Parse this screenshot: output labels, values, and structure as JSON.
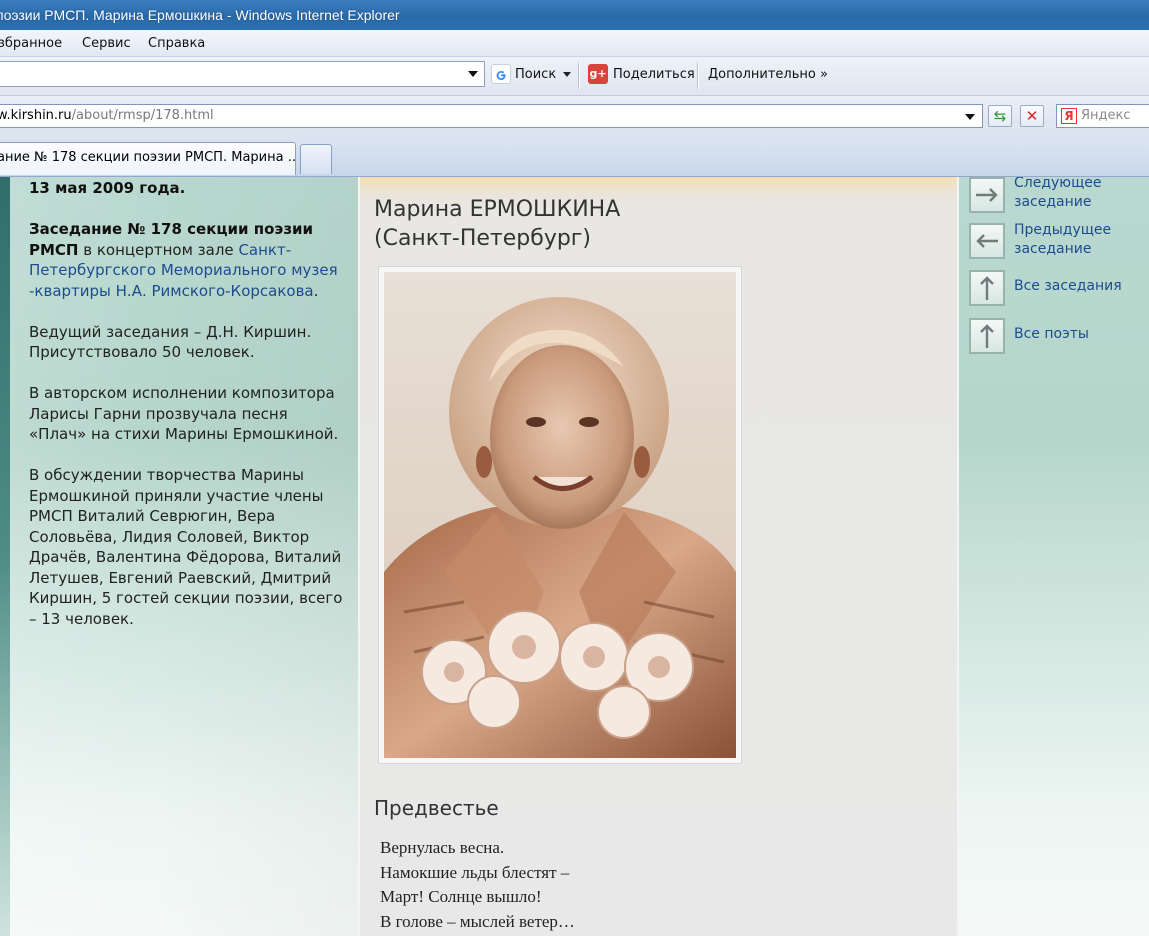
{
  "window": {
    "title": "поэзии РМСП. Марина Ермошкина - Windows Internet Explorer"
  },
  "menu": {
    "items": [
      "збранное",
      "Сервис",
      "Справка"
    ]
  },
  "toolbar": {
    "search_label": "Поиск",
    "share_label": "Поделиться",
    "more_label": "Дополнительно »"
  },
  "address": {
    "host": "w.kirshin.ru",
    "path": "/about/rmsp/178.html",
    "search_placeholder": "Яндекс"
  },
  "tabs": {
    "active_label": "ание № 178 секции поэзии РМСП. Марина ..."
  },
  "left": {
    "date": "13 мая 2009 года.",
    "meeting_bold": "Заседание № 178 секции поэзии РМСП",
    "meeting_text": " в концертном зале ",
    "venue_link": "Санкт-Петербургского Мемориального музея -квартиры Н.А. Римского-Корсакова",
    "host": "Ведущий заседания – Д.Н. Киршин. Присутствовало 50 человек.",
    "song": "В авторском исполнении композитора Ларисы Гарни прозвучала песня «Плач» на стихи Марины Ермошкиной.",
    "discussion": "В обсуждении творчества Марины Ермошкиной приняли участие члены РМСП Виталий Севрюгин, Вера Соловьёва, Лидия Соловей, Виктор Драчёв, Валентина Фёдорова, Виталий Летушев, Евгений Раевский, Дмитрий Киршин, 5 гостей секции поэзии, всего – 13 человек."
  },
  "poet": {
    "name": "Марина ЕРМОШКИНА",
    "city": "(Санкт-Петербург)"
  },
  "poem": {
    "title": "Предвестье",
    "lines": [
      "Вернулась весна.",
      "Намокшие льды блестят –",
      "Март! Солнце вышло!",
      "В голове – мыслей ветер…"
    ]
  },
  "nav": {
    "next": [
      "Следующее",
      "заседание"
    ],
    "prev": [
      "Предыдущее",
      "заседание"
    ],
    "all_meetings": "Все заседания",
    "all_poets": "Все поэты"
  }
}
